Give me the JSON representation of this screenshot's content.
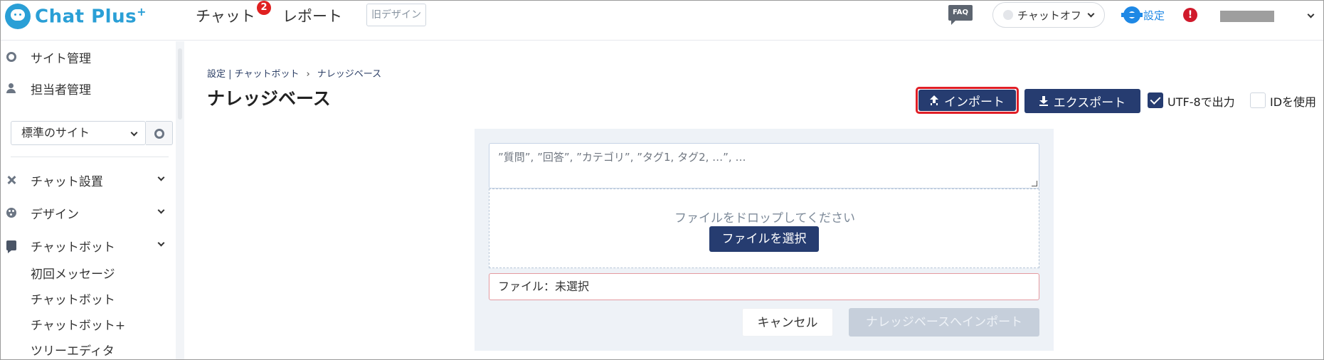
{
  "header": {
    "logo_text": "Chat Plus",
    "logo_plus": "+",
    "nav_chat": "チャット",
    "nav_chat_badge": "2",
    "nav_report": "レポート",
    "old_design": "旧デザイン",
    "faq": "FAQ",
    "chat_status": "チャットオフ",
    "settings": "設定",
    "alert": "!"
  },
  "sidebar": {
    "site_management": "サイト管理",
    "staff_management": "担当者管理",
    "site_select": "標準のサイト",
    "chat_setup": "チャット設置",
    "design": "デザイン",
    "chatbot": "チャットボット",
    "chatbot_sub": [
      "初回メッセージ",
      "チャットボット",
      "チャットボット+",
      "ツリーエディタ"
    ]
  },
  "main": {
    "breadcrumb": {
      "root": "設定 | チャットボット",
      "sep": "›",
      "current": "ナレッジベース"
    },
    "title": "ナレッジベース",
    "import_btn": "インポート",
    "export_btn": "エクスポート",
    "utf8_label": "UTF-8で出力",
    "utf8_checked": true,
    "id_label": "IDを使用",
    "id_checked": false,
    "textarea_placeholder": "”質問”, ”回答”, ”カテゴリ”, ”タグ1, タグ2, …”, …",
    "drop_text": "ファイルをドロップしてください",
    "select_file_btn": "ファイルを選択",
    "file_status": "ファイル：未選択",
    "cancel_btn": "キャンセル",
    "kb_import_btn": "ナレッジベースへインポート"
  },
  "colors": {
    "brand": "#2a9fd6",
    "primary": "#263c70",
    "highlight": "#e01e26",
    "badge": "#e02020"
  }
}
